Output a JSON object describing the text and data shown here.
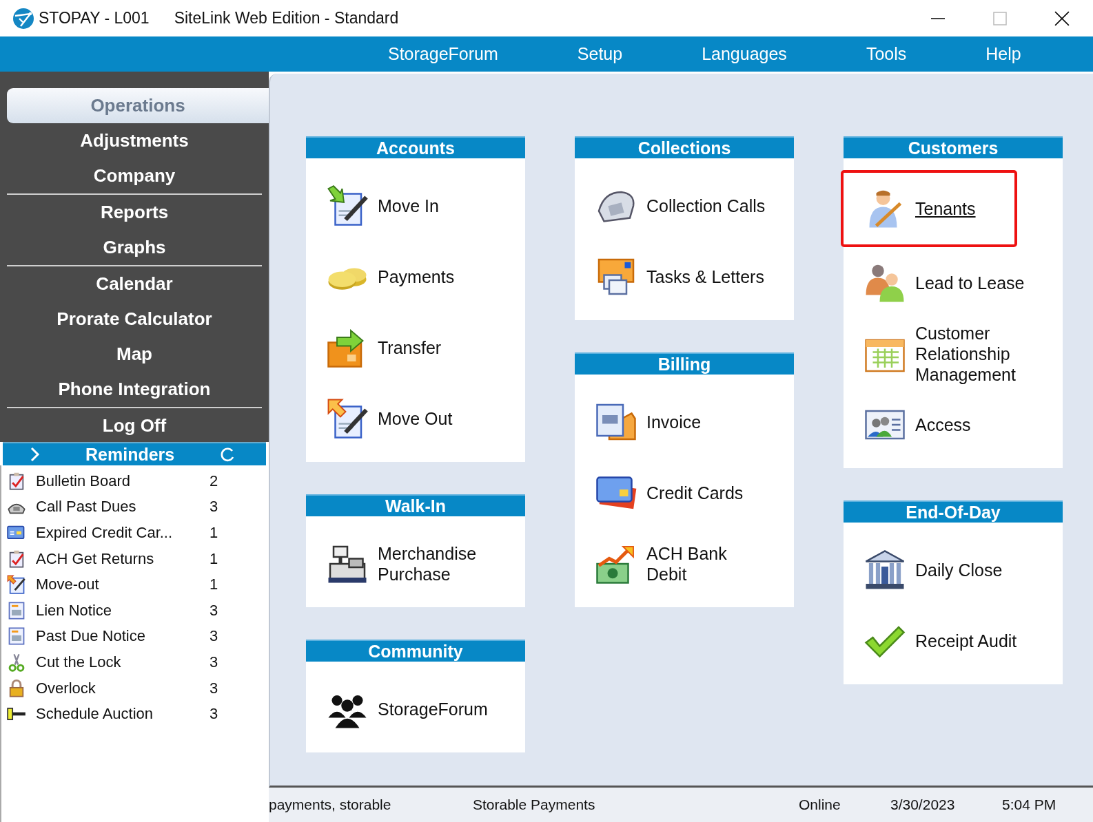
{
  "window": {
    "app_title": "STOPAY - L001",
    "title": "SiteLink Web Edition - Standard"
  },
  "menu": [
    "StorageForum",
    "Setup",
    "Languages",
    "Tools",
    "Help"
  ],
  "sidebar": {
    "groups": [
      {
        "items": [
          {
            "label": "Operations",
            "selected": true
          },
          {
            "label": "Adjustments",
            "selected": false
          },
          {
            "label": "Company",
            "selected": false
          }
        ]
      },
      {
        "items": [
          {
            "label": "Reports",
            "selected": false
          },
          {
            "label": "Graphs",
            "selected": false
          }
        ]
      },
      {
        "items": [
          {
            "label": "Calendar",
            "selected": false
          },
          {
            "label": "Prorate Calculator",
            "selected": false
          },
          {
            "label": "Map",
            "selected": false
          },
          {
            "label": "Phone Integration",
            "selected": false
          }
        ]
      },
      {
        "items": [
          {
            "label": "Log Off",
            "selected": false
          }
        ]
      }
    ]
  },
  "reminders": {
    "title": "Reminders",
    "items": [
      {
        "label": "Bulletin Board",
        "count": "2"
      },
      {
        "label": "Call Past Dues",
        "count": "3"
      },
      {
        "label": "Expired Credit Car...",
        "count": "1"
      },
      {
        "label": "ACH Get Returns",
        "count": "1"
      },
      {
        "label": "Move-out",
        "count": "1"
      },
      {
        "label": "Lien Notice",
        "count": "3"
      },
      {
        "label": "Past Due Notice",
        "count": "3"
      },
      {
        "label": "Cut the Lock",
        "count": "3"
      },
      {
        "label": "Overlock",
        "count": "3"
      },
      {
        "label": "Schedule Auction",
        "count": "3"
      }
    ]
  },
  "columns": [
    {
      "panels": [
        {
          "title": "Accounts",
          "items": [
            {
              "label": "Move In",
              "highlighted": false
            },
            {
              "label": "Payments",
              "highlighted": false
            },
            {
              "label": "Transfer",
              "highlighted": false
            },
            {
              "label": "Move Out",
              "highlighted": false
            }
          ]
        },
        {
          "title": "Walk-In",
          "items": [
            {
              "label": "Merchandise\nPurchase",
              "highlighted": false
            }
          ]
        },
        {
          "title": "Community",
          "items": [
            {
              "label": "StorageForum",
              "highlighted": false
            }
          ]
        }
      ]
    },
    {
      "panels": [
        {
          "title": "Collections",
          "items": [
            {
              "label": "Collection Calls",
              "highlighted": false
            },
            {
              "label": "Tasks & Letters",
              "highlighted": false
            }
          ]
        },
        {
          "title": "Billing",
          "items": [
            {
              "label": "Invoice",
              "highlighted": false
            },
            {
              "label": "Credit Cards",
              "highlighted": false
            },
            {
              "label": "ACH Bank\nDebit",
              "highlighted": false
            }
          ]
        }
      ]
    },
    {
      "panels": [
        {
          "title": "Customers",
          "items": [
            {
              "label": "Tenants",
              "highlighted": true
            },
            {
              "label": "Lead to Lease",
              "highlighted": false
            },
            {
              "label": "Customer\nRelationship\nManagement",
              "highlighted": false
            },
            {
              "label": "Access",
              "highlighted": false
            }
          ]
        },
        {
          "title": "End-Of-Day",
          "items": [
            {
              "label": "Daily Close",
              "highlighted": false
            },
            {
              "label": "Receipt Audit",
              "highlighted": false
            }
          ]
        }
      ]
    }
  ],
  "status_bar": [
    "payments, storable",
    "Storable Payments",
    "Online",
    "3/30/2023",
    "5:04 PM"
  ]
}
